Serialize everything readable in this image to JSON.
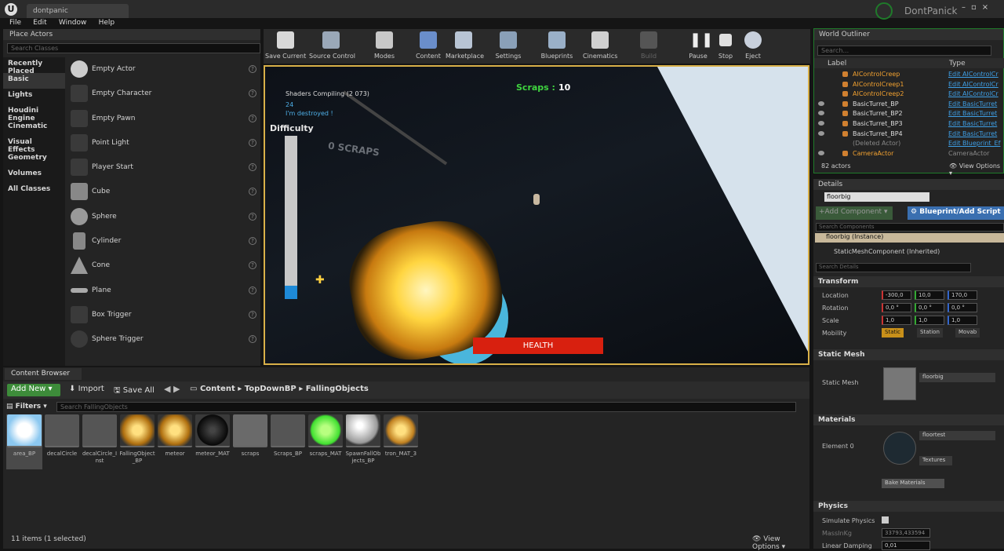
{
  "app": {
    "project_tab": "dontpanic",
    "user_name": "DontPanick"
  },
  "menu": [
    "File",
    "Edit",
    "Window",
    "Help"
  ],
  "place_actors": {
    "title": "Place Actors",
    "search_placeholder": "Search Classes",
    "categories": [
      "Recently Placed",
      "Basic",
      "Lights",
      "Houdini Engine",
      "Cinematic",
      "Visual Effects",
      "Geometry",
      "Volumes",
      "All Classes"
    ],
    "actors": [
      "Empty Actor",
      "Empty Character",
      "Empty Pawn",
      "Point Light",
      "Player Start",
      "Cube",
      "Sphere",
      "Cylinder",
      "Cone",
      "Plane",
      "Box Trigger",
      "Sphere Trigger"
    ]
  },
  "toolbar": [
    "Save Current",
    "Source Control",
    "Modes",
    "Content",
    "Marketplace",
    "Settings",
    "Blueprints",
    "Cinematics",
    "Build",
    "Pause",
    "Stop",
    "Eject"
  ],
  "viewport": {
    "shader_text": "Shaders Compiling (2 073)",
    "log_number": "24",
    "log_destroyed": "I'm destroyed !",
    "difficulty_label": "Difficulty",
    "difficulty_level": 0.08,
    "scraps_label": "Scraps :",
    "scraps_value": "10",
    "world_text": "0 SCRAPS",
    "health_label": "HEALTH"
  },
  "content_browser": {
    "tab": "Content Browser",
    "add_new": "Add New",
    "import": "Import",
    "save_all": "Save All",
    "path": [
      "Content",
      "TopDownBP",
      "FallingObjects"
    ],
    "filters": "Filters",
    "search_placeholder": "Search FallingObjects",
    "assets": [
      "area_BP",
      "decalCircle",
      "decalCircle_Inst",
      "FallingObject_BP",
      "meteor",
      "meteor_MAT",
      "scraps",
      "Scraps_BP",
      "scraps_MAT",
      "SpawnFallObjects_BP",
      "tron_MAT_3"
    ],
    "status": "11 items (1 selected)",
    "view_options": "View Options"
  },
  "world_outliner": {
    "title": "World Outliner",
    "search_placeholder": "Search...",
    "col_label": "Label",
    "col_type": "Type",
    "rows": [
      {
        "label": "AIControlCreep",
        "type": "Edit AIControlCr"
      },
      {
        "label": "AIControlCreep1",
        "type": "Edit AIControlCr"
      },
      {
        "label": "AIControlCreep2",
        "type": "Edit AIControlCr"
      },
      {
        "label": "BasicTurret_BP",
        "type": "Edit BasicTurret"
      },
      {
        "label": "BasicTurret_BP2",
        "type": "Edit BasicTurret"
      },
      {
        "label": "BasicTurret_BP3",
        "type": "Edit BasicTurret"
      },
      {
        "label": "BasicTurret_BP4",
        "type": "Edit BasicTurret"
      },
      {
        "label": "(Deleted Actor)",
        "type": "Edit Blueprint_Ef"
      },
      {
        "label": "CameraActor",
        "type": "CameraActor"
      }
    ],
    "count": "82 actors",
    "view_options": "View Options"
  },
  "details": {
    "title": "Details",
    "name": "floorbig",
    "add_component": "+Add Component",
    "blueprint_script": "Blueprint/Add Script",
    "search_components": "Search Components",
    "instance": "floorbig (Instance)",
    "component": "StaticMeshComponent (Inherited)",
    "search_details": "Search Details",
    "transform": "Transform",
    "location_label": "Location",
    "location": [
      "-300,0",
      "10,0",
      "170,0"
    ],
    "rotation_label": "Rotation",
    "rotation": [
      "0,0 °",
      "0,0 °",
      "0,0 °"
    ],
    "scale_label": "Scale",
    "scale": [
      "1,0",
      "1,0",
      "1,0"
    ],
    "mobility_label": "Mobility",
    "mobility": [
      "Static",
      "Station",
      "Movab"
    ],
    "static_mesh_section": "Static Mesh",
    "static_mesh_label": "Static Mesh",
    "static_mesh_value": "floorbig",
    "materials_section": "Materials",
    "element_label": "Element 0",
    "material_value": "floortest",
    "textures": "Textures",
    "bake": "Bake Materials",
    "physics_section": "Physics",
    "simulate": "Simulate Physics",
    "mass_label": "MassInKg",
    "mass_value": "33793,433594",
    "damping_label": "Linear Damping",
    "damping_value": "0,01"
  }
}
